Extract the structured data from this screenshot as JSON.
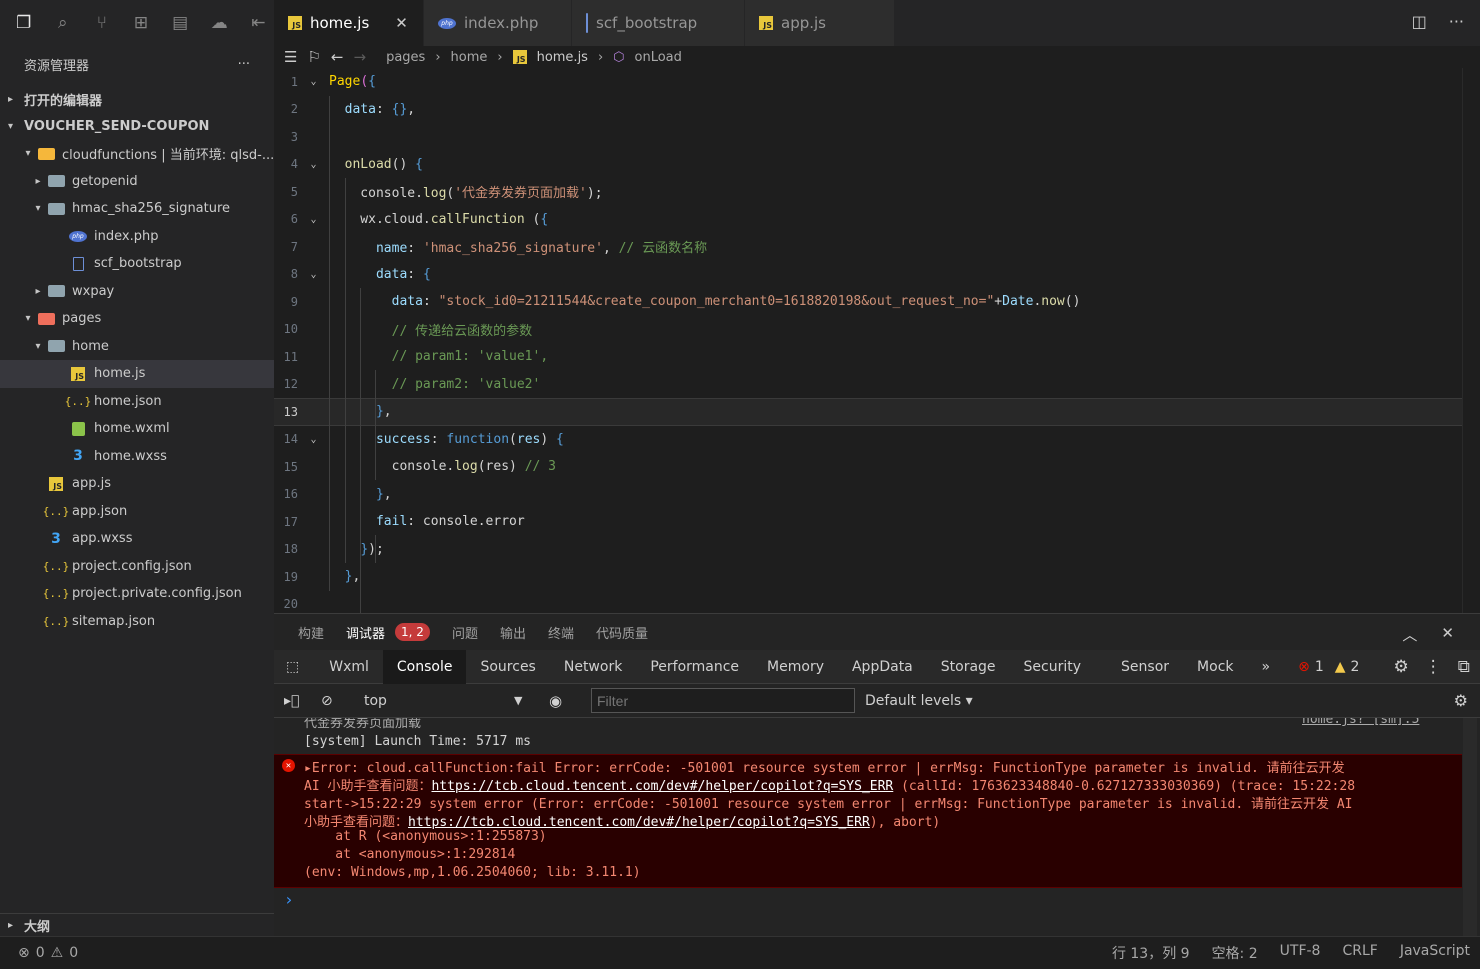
{
  "explorer": {
    "title": "资源管理器",
    "more": "···",
    "open_editors": "打开的编辑器",
    "project": "VOUCHER_SEND-COUPON",
    "outline": "大纲"
  },
  "tree": [
    {
      "label": "cloudfunctions | 当前环境: qlsd-...",
      "depth": 1,
      "icon": "cloud-folder-icon",
      "twisty": "▾"
    },
    {
      "label": "getopenid",
      "depth": 2,
      "icon": "folder-icon",
      "twisty": "▸"
    },
    {
      "label": "hmac_sha256_signature",
      "depth": 2,
      "icon": "folder-open-icon",
      "twisty": "▾"
    },
    {
      "label": "index.php",
      "depth": 3,
      "icon": "php-file-icon",
      "twisty": ""
    },
    {
      "label": "scf_bootstrap",
      "depth": 3,
      "icon": "file-icon",
      "twisty": ""
    },
    {
      "label": "wxpay",
      "depth": 2,
      "icon": "folder-icon",
      "twisty": "▸"
    },
    {
      "label": "pages",
      "depth": 1,
      "icon": "pages-folder-icon",
      "twisty": "▾"
    },
    {
      "label": "home",
      "depth": 2,
      "icon": "folder-open-icon",
      "twisty": "▾"
    },
    {
      "label": "home.js",
      "depth": 3,
      "icon": "js-file-icon",
      "twisty": "",
      "selected": true
    },
    {
      "label": "home.json",
      "depth": 3,
      "icon": "json-file-icon",
      "twisty": ""
    },
    {
      "label": "home.wxml",
      "depth": 3,
      "icon": "wxml-file-icon",
      "twisty": ""
    },
    {
      "label": "home.wxss",
      "depth": 3,
      "icon": "wxss-file-icon",
      "twisty": ""
    },
    {
      "label": "app.js",
      "depth": 2,
      "icon": "js-file-icon",
      "twisty": ""
    },
    {
      "label": "app.json",
      "depth": 2,
      "icon": "json-file-icon",
      "twisty": ""
    },
    {
      "label": "app.wxss",
      "depth": 2,
      "icon": "wxss-file-icon",
      "twisty": ""
    },
    {
      "label": "project.config.json",
      "depth": 2,
      "icon": "json-file-icon",
      "twisty": ""
    },
    {
      "label": "project.private.config.json",
      "depth": 2,
      "icon": "json-file-icon",
      "twisty": ""
    },
    {
      "label": "sitemap.json",
      "depth": 2,
      "icon": "json-file-icon",
      "twisty": ""
    }
  ],
  "tabs": [
    {
      "label": "home.js",
      "icon": "js-file-icon",
      "active": true,
      "close": "✕"
    },
    {
      "label": "index.php",
      "icon": "php-file-icon"
    },
    {
      "label": "scf_bootstrap",
      "icon": "file-icon"
    },
    {
      "label": "app.js",
      "icon": "js-file-icon"
    }
  ],
  "breadcrumb": {
    "a": "pages",
    "b": "home",
    "c": "home.js",
    "d": "onLoad"
  },
  "code": [
    {
      "n": "1",
      "fold": "⌄",
      "html": "<span class='y'>Page</span><span class='pb'>(</span><span class='k'>{</span>"
    },
    {
      "n": "2",
      "html": "  <span class='p'>data</span>: <span class='k'>{}</span>,"
    },
    {
      "n": "3",
      "html": ""
    },
    {
      "n": "4",
      "fold": "⌄",
      "html": "  <span class='f'>onLoad</span>() <span class='k'>{</span>"
    },
    {
      "n": "5",
      "html": "    console.<span class='f'>log</span>(<span class='s'>'代金券发券页面加载'</span>);"
    },
    {
      "n": "6",
      "fold": "⌄",
      "html": "    wx.cloud.<span class='f'>callFunction</span> (<span class='k'>{</span>"
    },
    {
      "n": "7",
      "html": "      <span class='p'>name</span>: <span class='s'>'hmac_sha256_signature'</span>, <span class='c'>// 云函数名称</span>"
    },
    {
      "n": "8",
      "fold": "⌄",
      "html": "      <span class='p'>data</span>: <span class='k'>{</span>"
    },
    {
      "n": "9",
      "html": "        <span class='p'>data</span>: <span class='s'>\"stock_id0=21211544&amp;create_coupon_merchant0=1618820198&amp;out_request_no=\"</span>+<span class='p'>Date</span>.<span class='f'>now</span>()"
    },
    {
      "n": "10",
      "html": "        <span class='c'>// 传递给云函数的参数</span>"
    },
    {
      "n": "11",
      "html": "        <span class='c'>// param1: 'value1',</span>"
    },
    {
      "n": "12",
      "html": "        <span class='c'>// param2: 'value2'</span>"
    },
    {
      "n": "13",
      "cur": true,
      "html": "      <span class='k'>}</span>,"
    },
    {
      "n": "14",
      "fold": "⌄",
      "html": "      <span class='p'>success</span>: <span class='k'>function</span>(<span class='p'>res</span>) <span class='k'>{</span>"
    },
    {
      "n": "15",
      "html": "        console.<span class='f'>log</span>(res) <span class='c'>// 3</span>"
    },
    {
      "n": "16",
      "html": "      <span class='k'>}</span>,"
    },
    {
      "n": "17",
      "html": "      <span class='p'>fail</span>: console.error"
    },
    {
      "n": "18",
      "html": "    <span class='k'>}</span>);"
    },
    {
      "n": "19",
      "html": "  <span class='k'>}</span>,"
    },
    {
      "n": "20",
      "html": ""
    }
  ],
  "panel_tabs": [
    {
      "label": "构建"
    },
    {
      "label": "调试器",
      "active": true,
      "badge": "1, 2"
    },
    {
      "label": "问题"
    },
    {
      "label": "输出"
    },
    {
      "label": "终端"
    },
    {
      "label": "代码质量"
    }
  ],
  "dev_tabs": [
    "Wxml",
    "Console",
    "Sources",
    "Network",
    "Performance",
    "Memory",
    "AppData",
    "Storage",
    "Security",
    "Sensor",
    "Mock"
  ],
  "dev_active": "Console",
  "counts": {
    "errors": "1",
    "warnings": "2"
  },
  "console_toolbar": {
    "context": "top",
    "filter_placeholder": "Filter",
    "levels": "Default levels ▾"
  },
  "console": {
    "partial": "代金券发券页面加载",
    "partial_src": "home.js? [sm]:5",
    "launch": "[system] Launch Time: 5717 ms",
    "err": [
      "▸Error: cloud.callFunction:fail Error: errCode: -501001 resource system error | errMsg: FunctionType parameter is invalid. 请前往云开发",
      "AI 小助手查看问题：",
      "https://tcb.cloud.tencent.com/dev#/helper/copilot?q=SYS_ERR",
      " (callId: 1763623348840-0.627127333030369) (trace: 15:22:28",
      "start->15:22:29 system error (Error: errCode: -501001 resource system error | errMsg: FunctionType parameter is invalid. 请前往云开发 AI",
      "小助手查看问题：",
      "https://tcb.cloud.tencent.com/dev#/helper/copilot?q=SYS_ERR",
      "), abort)",
      "    at R (<anonymous>:1:255873)",
      "    at <anonymous>:1:292814",
      "(env: Windows,mp,1.06.2504060; lib: 3.11.1)"
    ],
    "prompt": "›"
  },
  "status": {
    "errors": "0",
    "warnings": "0",
    "position": "行 13，列 9",
    "spaces": "空格: 2",
    "encoding": "UTF-8",
    "eol": "CRLF",
    "lang": "JavaScript"
  }
}
